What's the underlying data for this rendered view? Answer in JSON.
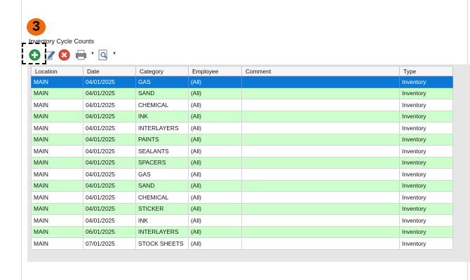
{
  "step_badge": "3",
  "panel_title": "Inventory Cycle Counts",
  "toolbar": {
    "icons": [
      "add-icon",
      "edit-icon",
      "delete-icon",
      "print-icon",
      "preview-icon"
    ]
  },
  "grid": {
    "columns": [
      "Location",
      "Date",
      "Category",
      "Employee",
      "Comment",
      "Type"
    ],
    "rows": [
      [
        "MAIN",
        "04/01/2025",
        "GAS",
        "(All)",
        "",
        "Inventory"
      ],
      [
        "MAIN",
        "04/01/2025",
        "SAND",
        "(All)",
        "",
        "Inventory"
      ],
      [
        "MAIN",
        "04/01/2025",
        "CHEMICAL",
        "(All)",
        "",
        "Inventory"
      ],
      [
        "MAIN",
        "04/01/2025",
        "INK",
        "(All)",
        "",
        "Inventory"
      ],
      [
        "MAIN",
        "04/01/2025",
        "INTERLAYERS",
        "(All)",
        "",
        "Inventory"
      ],
      [
        "MAIN",
        "04/01/2025",
        "PAINTS",
        "(All)",
        "",
        "Inventory"
      ],
      [
        "MAIN",
        "04/01/2025",
        "SEALANTS",
        "(All)",
        "",
        "Inventory"
      ],
      [
        "MAIN",
        "04/01/2025",
        "SPACERS",
        "(All)",
        "",
        "Inventory"
      ],
      [
        "MAIN",
        "04/01/2025",
        "GAS",
        "(All)",
        "",
        "Inventory"
      ],
      [
        "MAIN",
        "04/01/2025",
        "SAND",
        "(All)",
        "",
        "Inventory"
      ],
      [
        "MAIN",
        "04/01/2025",
        "CHEMICAL",
        "(All)",
        "",
        "Inventory"
      ],
      [
        "MAIN",
        "04/01/2025",
        "STICKER",
        "(All)",
        "",
        "Inventory"
      ],
      [
        "MAIN",
        "04/01/2025",
        "INK",
        "(All)",
        "",
        "Inventory"
      ],
      [
        "MAIN",
        "06/01/2025",
        "INTERLAYERS",
        "(All)",
        "",
        "Inventory"
      ],
      [
        "MAIN",
        "07/01/2025",
        "STOCK SHEETS",
        "(All)",
        "",
        "Inventory"
      ]
    ],
    "selected_row": 0
  },
  "colors": {
    "badge": "#f06a10",
    "selected_row": "#0a78d7",
    "alt_row": "#ccffcc"
  }
}
